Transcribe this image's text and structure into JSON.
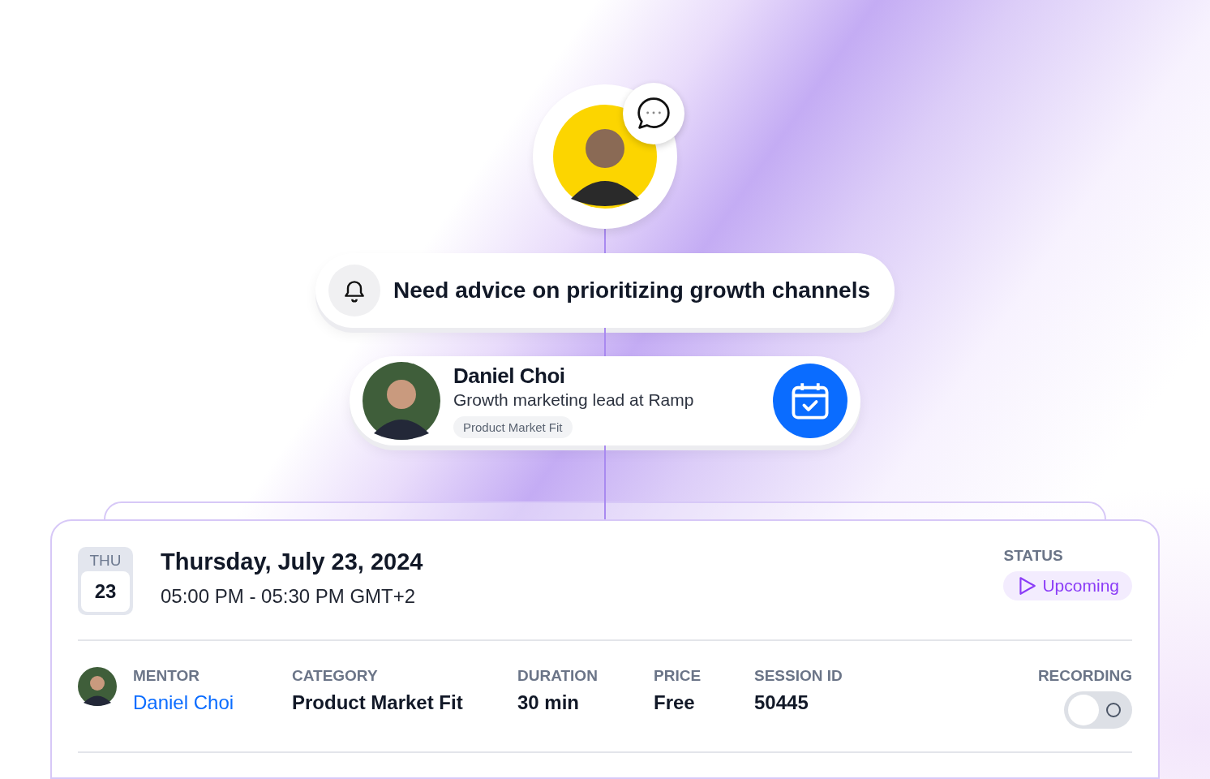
{
  "question": {
    "text": "Need advice on prioritizing growth channels"
  },
  "mentor_card": {
    "name": "Daniel Choi",
    "title": "Growth marketing lead at Ramp",
    "tag": "Product Market Fit"
  },
  "session": {
    "weekday": "THU",
    "day": "23",
    "date": "Thursday, July 23, 2024",
    "time": "05:00 PM - 05:30 PM GMT+2",
    "status_label": "STATUS",
    "status": "Upcoming",
    "details": [
      {
        "label": "MENTOR",
        "value": "Daniel Choi",
        "kind": "link"
      },
      {
        "label": "CATEGORY",
        "value": "Product Market Fit",
        "kind": "text"
      },
      {
        "label": "DURATION",
        "value": "30 min",
        "kind": "text"
      },
      {
        "label": "PRICE",
        "value": "Free",
        "kind": "text"
      },
      {
        "label": "SESSION ID",
        "value": "50445",
        "kind": "text"
      }
    ],
    "recording": {
      "label": "RECORDING",
      "on": false
    }
  }
}
